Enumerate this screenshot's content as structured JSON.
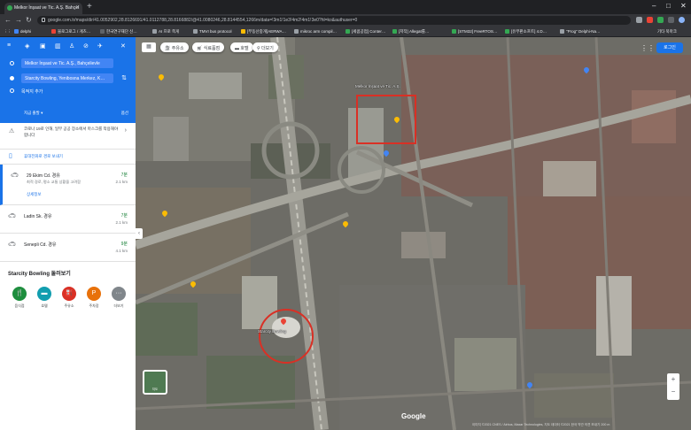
{
  "browser": {
    "tab_title": "Melkor İnşaat ve Tic. A.Ş. Bahçel",
    "url": "google.com.tr/maps/dir/41.0052902,28.8126691/41.0112788,28.8166882/@41.0080246,28.8144554,1266m/data=!3m1!1e3!4m2!4m1!3e0?hl=ko&authuser=0",
    "new_tab_symbol": "+",
    "window_controls": [
      "–",
      "□",
      "✕"
    ],
    "bookmarks": [
      {
        "label": "delphi",
        "color": "#4285f4"
      },
      {
        "label": "블로그로그 / 게츠…",
        "color": "#ea4335"
      },
      {
        "label": "한국연구재단 신…",
        "color": "#5f6368"
      },
      {
        "label": "AI 프로 쪽게",
        "color": "#9aa0a6"
      },
      {
        "label": "TMVI bus protocol",
        "color": "#9aa0a6"
      },
      {
        "label": "[부동산중개]AERWA…",
        "color": "#fbbc04"
      },
      {
        "label": "mikroc arm compil…",
        "color": "#9aa0a6"
      },
      {
        "label": "[세콤공업] Conter…",
        "color": "#34a853"
      },
      {
        "label": "[저작] Allegat를…",
        "color": "#34a853"
      },
      {
        "label": "[STM32] FreeRTOS…",
        "color": "#34a853"
      },
      {
        "label": "[유무판소프트] 4.D…",
        "color": "#34a853"
      },
      {
        "label": "\"Prog\" Delphi-Na…",
        "color": "#9aa0a6"
      }
    ],
    "other_bookmarks": "기타 북마크"
  },
  "panel": {
    "origin": "Melkor İnşaat ve Tic. A.Ş., Bahçelievle",
    "destination": "Starcity Bowling, Yenibosna Merkez, K…",
    "add_destination": "목적지 추가",
    "depart_now": "지금 출발",
    "options": "옵션",
    "warning": "코로나 19로 인해, 일부 공공 장소에서 마스크를 착용해야 합니다",
    "send_to_phone": "휴대전화로 경로 보내기",
    "routes": [
      {
        "name": "29 Ekim Cd. 경유",
        "time": "7분",
        "distance": "2.1 km",
        "desc": "최적 경로, 평소 교통 상황을 고려함",
        "details": "상세정보"
      },
      {
        "name": "Ladin Sk. 경유",
        "time": "7분",
        "distance": "2.1 km",
        "desc": "",
        "details": ""
      },
      {
        "name": "Senepli Cd. 경유",
        "time": "9분",
        "distance": "4.1 km",
        "desc": "",
        "details": ""
      }
    ],
    "explore_title": "Starcity Bowling 둘러보기",
    "categories": [
      {
        "label": "음식점",
        "icon": "restaurant-icon",
        "glyph": "🍴",
        "color": "#1e8e3e"
      },
      {
        "label": "호텔",
        "icon": "hotel-icon",
        "glyph": "▬",
        "color": "#129eaf"
      },
      {
        "label": "주유소",
        "icon": "gas-station-icon",
        "glyph": "⛽",
        "color": "#d93025"
      },
      {
        "label": "주차장",
        "icon": "parking-icon",
        "glyph": "P",
        "color": "#e8710a"
      },
      {
        "label": "더보기",
        "icon": "more-icon",
        "glyph": "···",
        "color": "#80868b"
      }
    ]
  },
  "map": {
    "chips": [
      {
        "label": "주유소",
        "icon": "gas-station-icon"
      },
      {
        "label": "식료품점",
        "icon": "grocery-icon"
      },
      {
        "label": "호텔",
        "icon": "hotel-icon"
      },
      {
        "label": "더보기",
        "icon": "search-icon"
      }
    ],
    "login": "로그인",
    "layer_label": "지도",
    "labels": [
      "Melkor İnşaat ve Tic. A.Ş.",
      "Starcity Bowling"
    ],
    "google": "Google",
    "attribution": "이미지 ©2021 CNES / Airbus, Maxar Technologies, 지도 데이터 ©2021   한국   약관   의견 보내기   200 m"
  }
}
